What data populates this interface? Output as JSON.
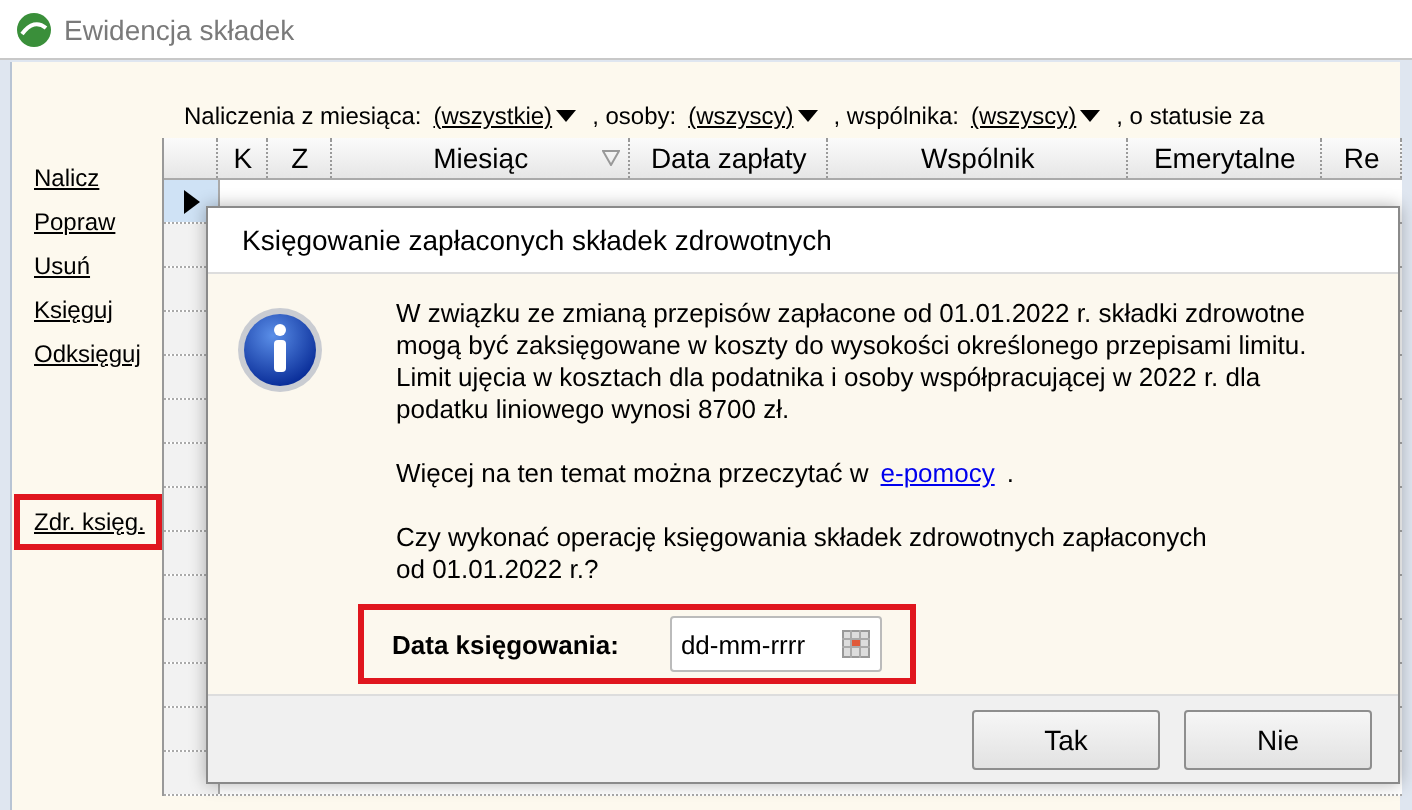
{
  "window": {
    "title": "Ewidencja składek"
  },
  "filters": [
    {
      "label": "Naliczenia z miesiąca:",
      "value": "(wszystkie)"
    },
    {
      "label": ", osoby:",
      "value": "(wszyscy)"
    },
    {
      "label": ", wspólnika:",
      "value": "(wszyscy)"
    },
    {
      "label": ", o statusie za"
    }
  ],
  "sidebar": {
    "groups": [
      [
        {
          "label": "Nalicz",
          "highlighted": false
        },
        {
          "label": "Popraw",
          "highlighted": false
        },
        {
          "label": "Usuń",
          "highlighted": false
        },
        {
          "label": "Księguj",
          "highlighted": false
        },
        {
          "label": "Odksięguj",
          "highlighted": false
        }
      ],
      [
        {
          "label": "Zdr. księg.",
          "highlighted": true
        }
      ]
    ]
  },
  "table": {
    "columns": [
      {
        "label": "K",
        "sorted": false
      },
      {
        "label": "Z",
        "sorted": false
      },
      {
        "label": "Miesiąc",
        "sorted": true
      },
      {
        "label": "Data zapłaty",
        "sorted": false
      },
      {
        "label": "Wspólnik",
        "sorted": false
      },
      {
        "label": "Emerytalne",
        "sorted": false
      },
      {
        "label": "Re",
        "sorted": false
      }
    ]
  },
  "dialog": {
    "title": "Księgowanie zapłaconych składek zdrowotnych",
    "message": "W związku ze zmianą przepisów zapłacone od 01.01.2022 r. składki zdrowotne\nmogą być zaksięgowane w koszty do wysokości określonego przepisami limitu.\nLimit ujęcia w kosztach dla podatnika i osoby współpracującej w 2022 r. dla\npodatku liniowego wynosi 8700 zł.",
    "more_info": {
      "text": "Więcej na ten temat można przeczytać w",
      "link": "e-pomocy",
      "suffix": "."
    },
    "question": "Czy wykonać operację księgowania składek zdrowotnych zapłaconych\nod 01.01.2022 r.?",
    "date_field": {
      "label": "Data księgowania:",
      "placeholder": "dd-mm-rrrr",
      "highlighted": true
    },
    "buttons": [
      "Tak",
      "Nie"
    ]
  }
}
